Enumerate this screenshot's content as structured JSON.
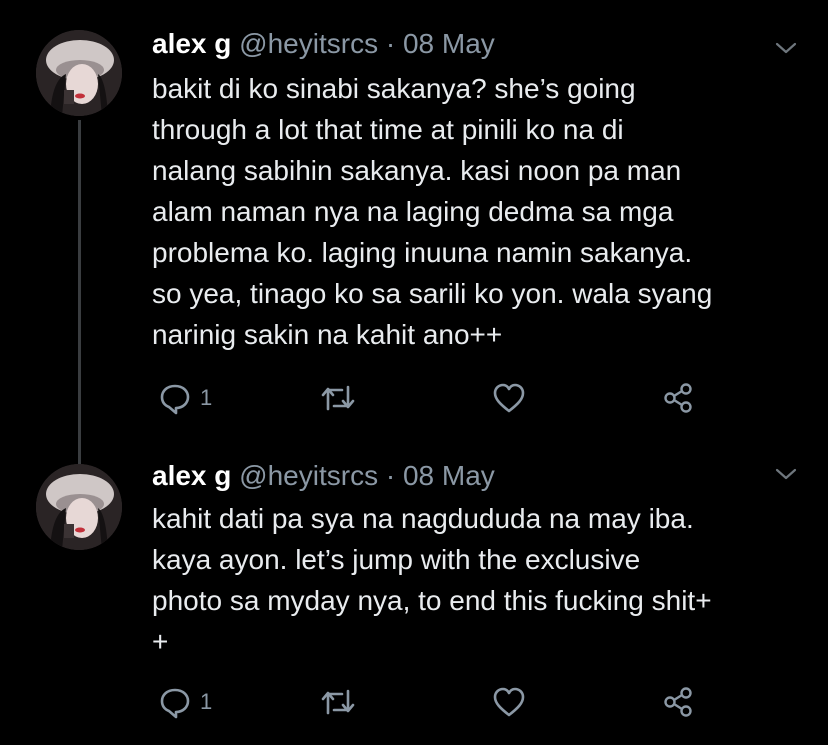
{
  "colors": {
    "background": "#000000",
    "text": "#e9ecef",
    "muted": "#8b98a5",
    "thread_line": "#3a3d40"
  },
  "tweets": [
    {
      "name": "alex g",
      "handle": "@heyitsrcs",
      "separator": "·",
      "date": "08 May",
      "text": "bakit di ko sinabi sakanya? she’s going\nthrough a lot that time at pinili ko na di\nnalang sabihin sakanya. kasi noon pa man\nalam naman nya na laging dedma sa mga\nproblema ko. laging inuuna namin sakanya.\nso yea, tinago ko sa sarili ko yon. wala syang\nnarinig sakin na kahit ano++",
      "reply_count": "1",
      "icons": [
        "reply-icon",
        "retweet-icon",
        "like-icon",
        "share-icon",
        "chevron-down-icon"
      ]
    },
    {
      "name": "alex g",
      "handle": "@heyitsrcs",
      "separator": "·",
      "date": "08 May",
      "text": "kahit dati pa sya na nagdududa na may iba.\nkaya ayon. let’s jump with the exclusive\nphoto sa myday nya, to end this fucking shit+\n+",
      "reply_count": "1",
      "icons": [
        "reply-icon",
        "retweet-icon",
        "like-icon",
        "share-icon",
        "chevron-down-icon"
      ]
    }
  ]
}
